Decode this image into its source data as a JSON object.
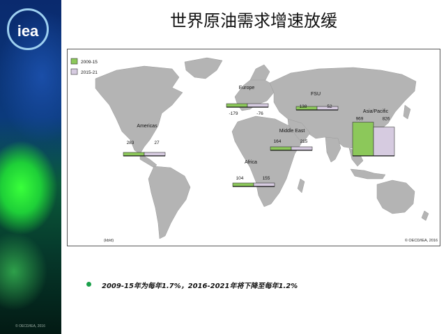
{
  "slide": {
    "title": "世界原油需求增速放缓",
    "logo_text": "iea",
    "footer_credit": "© OECD/IEA, 2016",
    "bullet": "2009-15年为每年1.7%，2016-2021年将下降至每年1.2%"
  },
  "colors": {
    "series_2009_15": "#8cc85a",
    "series_2015_21": "#d6cbe0",
    "bullet_dot": "#1aa04a",
    "land": "#b4b4b4"
  },
  "chart_data": {
    "type": "bar",
    "title": "",
    "unit_label": "(kb/d)",
    "copyright": "© OECD/IEA, 2016",
    "legend_position": "top-left",
    "series": [
      {
        "name": "2009-15",
        "values": [
          283,
          -179,
          138,
          164,
          104,
          969
        ]
      },
      {
        "name": "2015-21",
        "values": [
          27,
          -76,
          52,
          215,
          155,
          826
        ]
      }
    ],
    "categories": [
      "Americas",
      "Europe",
      "FSU",
      "Middle East",
      "Africa",
      "Asia/Pacific"
    ],
    "regions": [
      {
        "name": "Americas",
        "v2009_15": 283,
        "v2015_21": 27,
        "l2009_15": "283",
        "l2015_21": "27"
      },
      {
        "name": "Europe",
        "v2009_15": -179,
        "v2015_21": -76,
        "l2009_15": "-179",
        "l2015_21": "-76"
      },
      {
        "name": "FSU",
        "v2009_15": 138,
        "v2015_21": 52,
        "l2009_15": "138",
        "l2015_21": "52"
      },
      {
        "name": "Middle East",
        "v2009_15": 164,
        "v2015_21": 215,
        "l2009_15": "164",
        "l2015_21": "215"
      },
      {
        "name": "Africa",
        "v2009_15": 104,
        "v2015_21": 155,
        "l2009_15": "104",
        "l2015_21": "155"
      },
      {
        "name": "Asia/Pacific",
        "v2009_15": 969,
        "v2015_21": 826,
        "l2009_15": "969",
        "l2015_21": "826"
      }
    ]
  }
}
